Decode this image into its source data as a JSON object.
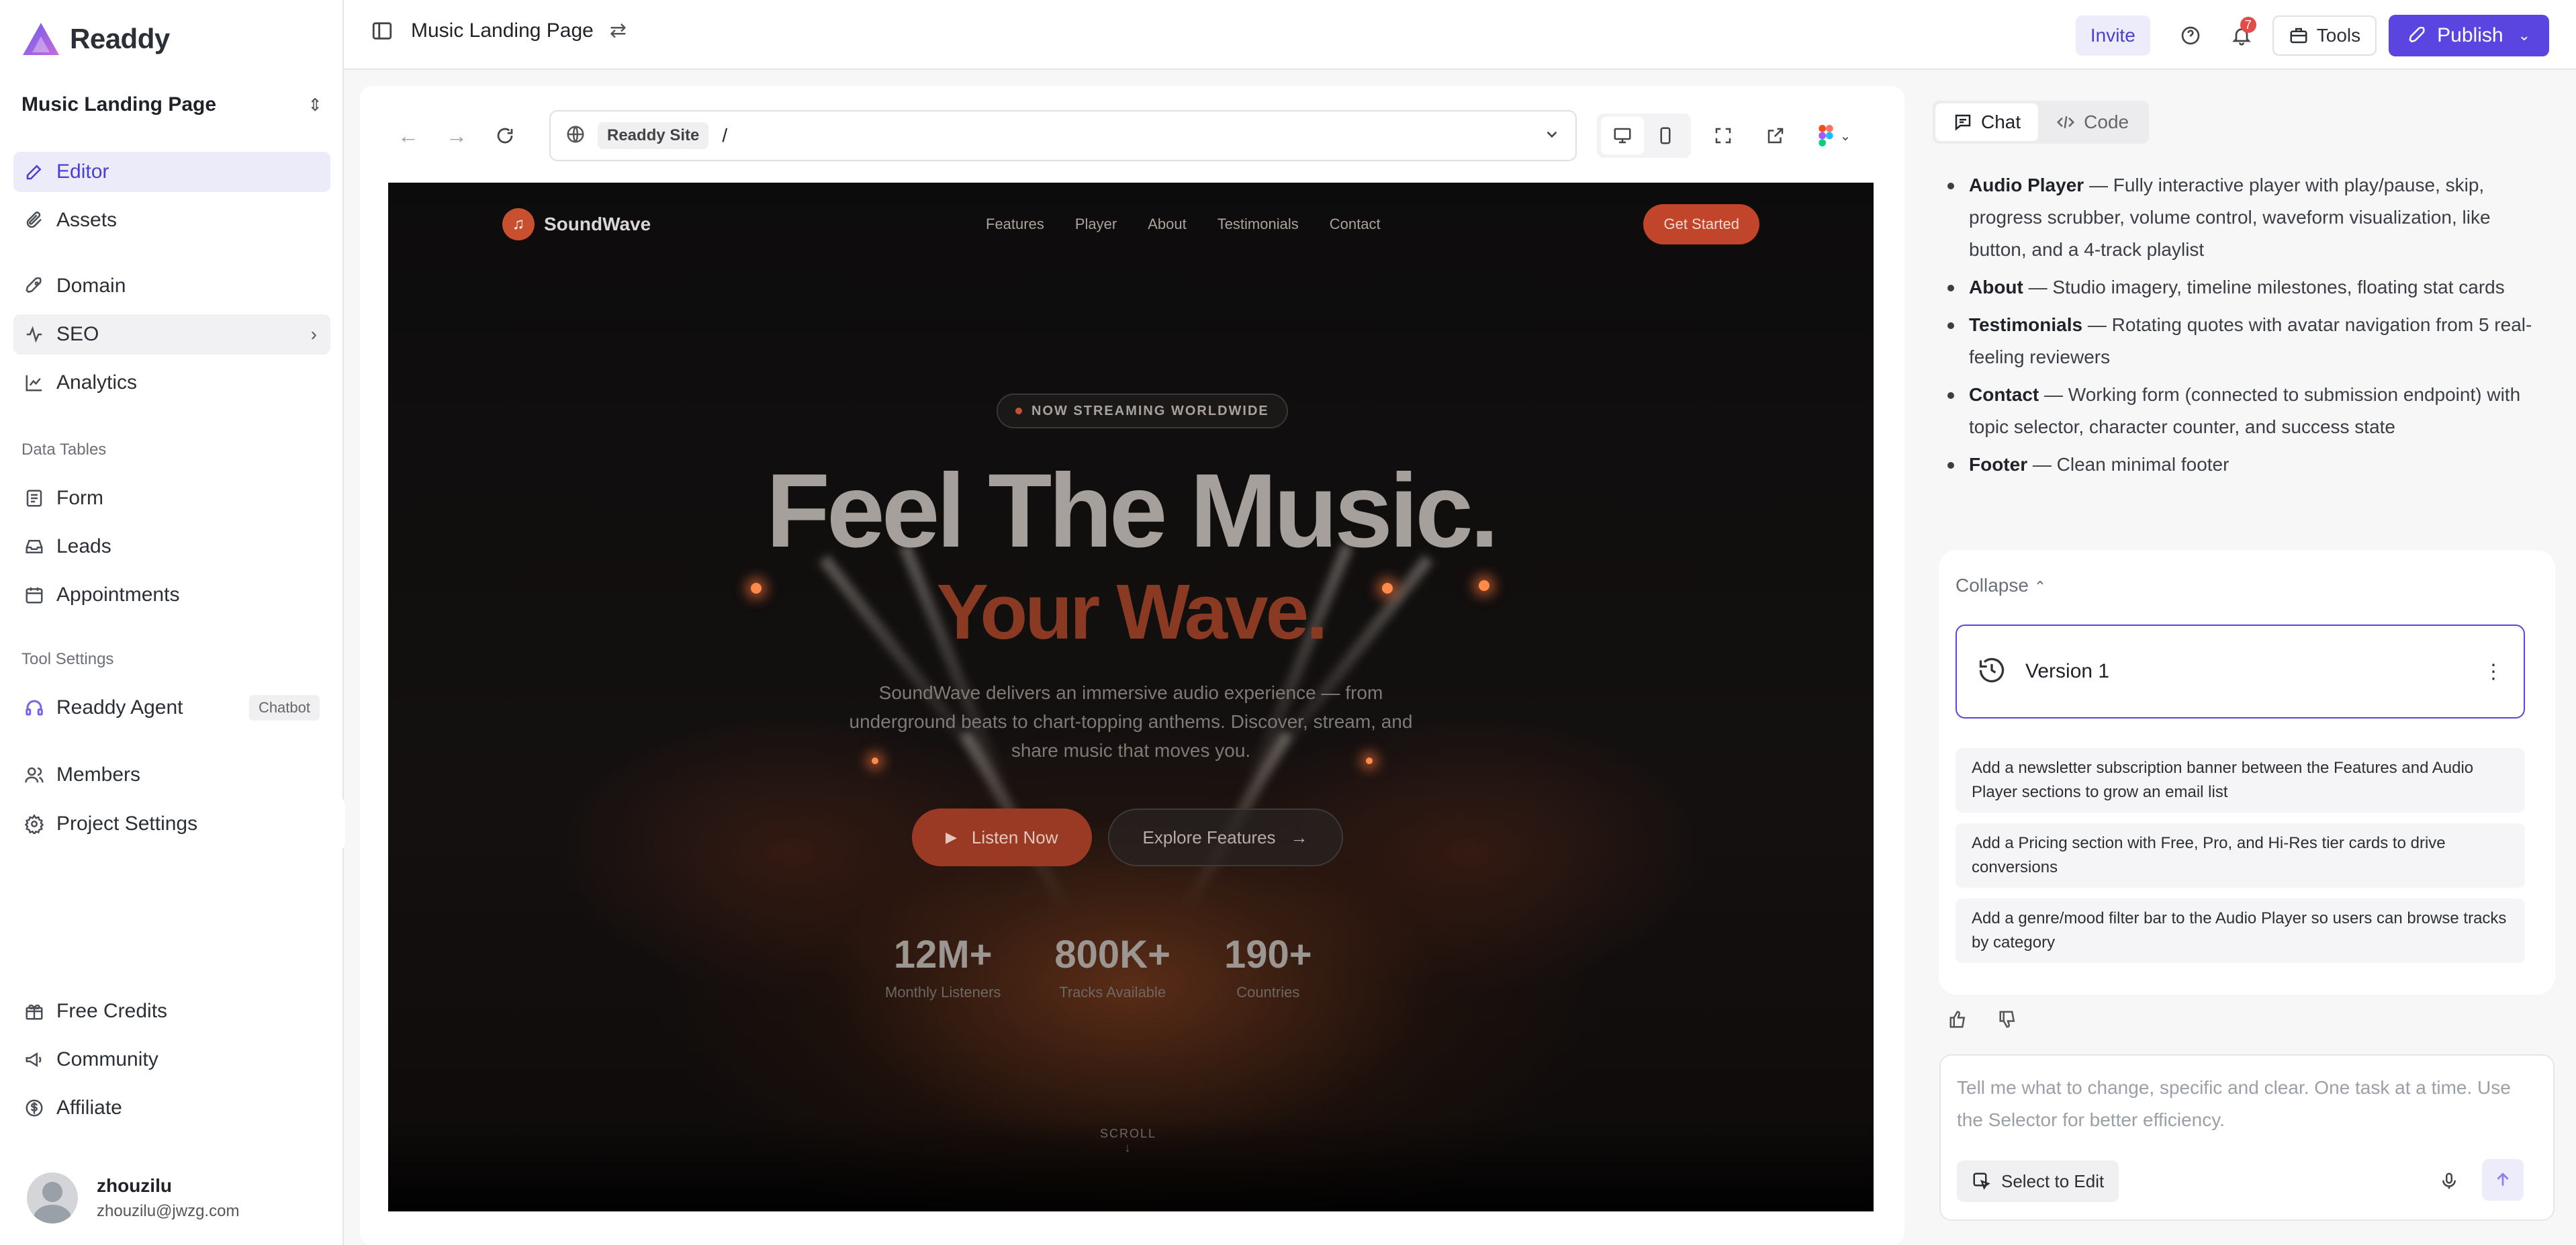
{
  "app": {
    "name": "Readdy",
    "brand_color": "#5b45e0"
  },
  "sidebar": {
    "project_name": "Music Landing Page",
    "items": [
      {
        "label": "Editor",
        "icon": "editor-icon"
      },
      {
        "label": "Assets",
        "icon": "paperclip-icon"
      },
      {
        "label": "Domain",
        "icon": "rocket-icon"
      },
      {
        "label": "SEO",
        "icon": "seo-icon"
      },
      {
        "label": "Analytics",
        "icon": "chart-line-icon"
      }
    ],
    "data_tables_label": "Data Tables",
    "data_tables": [
      {
        "label": "Form",
        "icon": "form-icon"
      },
      {
        "label": "Leads",
        "icon": "inbox-icon"
      },
      {
        "label": "Appointments",
        "icon": "calendar-icon"
      }
    ],
    "tool_settings_label": "Tool Settings",
    "agent": {
      "label": "Readdy Agent",
      "tag": "Chatbot"
    },
    "members_label": "Members",
    "project_settings_label": "Project Settings",
    "bottom_items": [
      {
        "label": "Free Credits",
        "icon": "gift-icon"
      },
      {
        "label": "Community",
        "icon": "megaphone-icon"
      },
      {
        "label": "Affiliate",
        "icon": "dollar-icon"
      }
    ],
    "user": {
      "name": "zhouzilu",
      "email": "zhouzilu@jwzg.com"
    }
  },
  "topbar": {
    "title": "Music Landing Page",
    "invite_label": "Invite",
    "notification_count": "7",
    "tools_label": "Tools",
    "publish_label": "Publish"
  },
  "browser": {
    "site_label": "Readdy Site",
    "path": "/"
  },
  "preview": {
    "logo": "SoundWave",
    "nav_links": [
      "Features",
      "Player",
      "About",
      "Testimonials",
      "Contact"
    ],
    "cta": "Get Started",
    "pill": "NOW STREAMING WORLDWIDE",
    "headline": "Feel The Music.",
    "headline_accent": "Your Wave.",
    "subtitle": "SoundWave delivers an immersive audio experience — from underground beats to chart-topping anthems. Discover, stream, and share music that moves you.",
    "listen_label": "Listen Now",
    "explore_label": "Explore Features",
    "stats": [
      {
        "value": "12M+",
        "label": "Monthly Listeners"
      },
      {
        "value": "800K+",
        "label": "Tracks Available"
      },
      {
        "value": "190+",
        "label": "Countries"
      }
    ],
    "scroll_label": "SCROLL",
    "accent_color": "#c8502e"
  },
  "chat": {
    "tabs": [
      {
        "label": "Chat"
      },
      {
        "label": "Code"
      }
    ],
    "bullets": [
      {
        "title": "Audio Player",
        "text": " — Fully interactive player with play/pause, skip, progress scrubber, volume control, waveform visualization, like button, and a 4-track playlist"
      },
      {
        "title": "About",
        "text": " — Studio imagery, timeline milestones, floating stat cards"
      },
      {
        "title": "Testimonials",
        "text": " — Rotating quotes with avatar navigation from 5 real-feeling reviewers"
      },
      {
        "title": "Contact",
        "text": " — Working form (connected to submission endpoint) with topic selector, character counter, and success state"
      },
      {
        "title": "Footer",
        "text": " — Clean minimal footer"
      }
    ],
    "collapse_label": "Collapse",
    "version_label": "Version 1",
    "suggestions": [
      "Add a newsletter subscription banner between the Features and Audio Player sections to grow an email list",
      "Add a Pricing section with Free, Pro, and Hi-Res tier cards to drive conversions",
      "Add a genre/mood filter bar to the Audio Player so users can browse tracks by category"
    ],
    "input_placeholder": "Tell me what to change, specific and clear. One task at a time. Use the Selector for better efficiency.",
    "select_to_edit_label": "Select to Edit"
  }
}
